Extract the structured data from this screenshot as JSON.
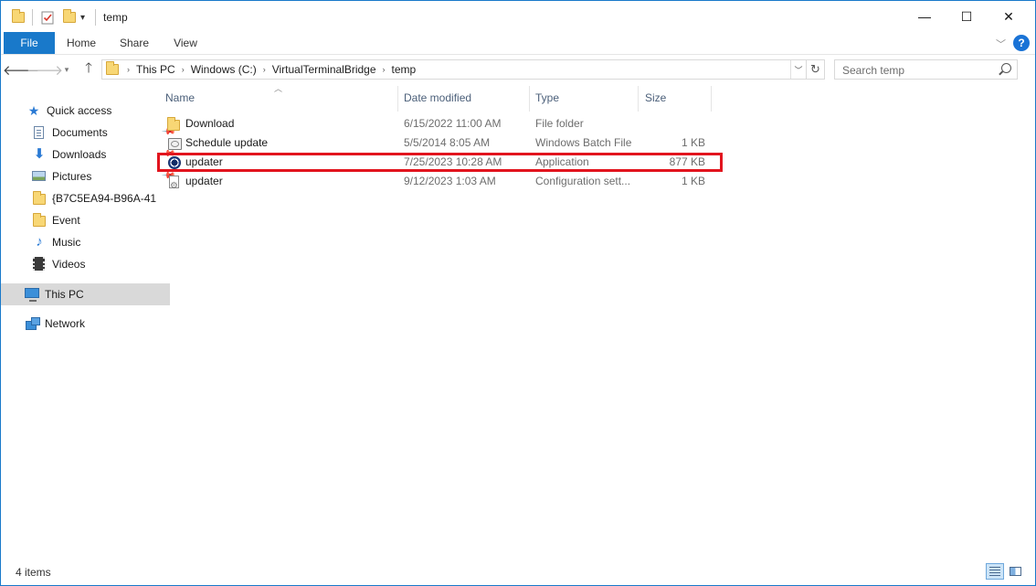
{
  "window": {
    "title": "temp",
    "minimize": "—",
    "maximize": "☐",
    "close": "✕"
  },
  "ribbon": {
    "tabs": [
      "File",
      "Home",
      "Share",
      "View"
    ],
    "help": "?"
  },
  "address": {
    "crumbs": [
      "This PC",
      "Windows (C:)",
      "VirtualTerminalBridge",
      "temp"
    ],
    "search_placeholder": "Search temp"
  },
  "nav": {
    "items": [
      {
        "label": "Quick access",
        "icon": "star-icon"
      },
      {
        "label": "Documents",
        "icon": "documents-icon",
        "pinned": true
      },
      {
        "label": "Downloads",
        "icon": "downloads-icon",
        "pinned": true
      },
      {
        "label": "Pictures",
        "icon": "pictures-icon",
        "pinned": true
      },
      {
        "label": "{B7C5EA94-B96A-41",
        "icon": "folder-icon"
      },
      {
        "label": "Event",
        "icon": "folder-icon"
      },
      {
        "label": "Music",
        "icon": "music-icon"
      },
      {
        "label": "Videos",
        "icon": "videos-icon"
      },
      {
        "label": "This PC",
        "icon": "this-pc-icon",
        "selected": true
      },
      {
        "label": "Network",
        "icon": "network-icon"
      }
    ]
  },
  "columns": {
    "name": "Name",
    "date": "Date modified",
    "type": "Type",
    "size": "Size"
  },
  "files": [
    {
      "name": "Download",
      "date": "6/15/2022 11:00 AM",
      "type": "File folder",
      "size": "",
      "icon": "folder-icon"
    },
    {
      "name": "Schedule update",
      "date": "5/5/2014 8:05 AM",
      "type": "Windows Batch File",
      "size": "1 KB",
      "icon": "batch-file-icon"
    },
    {
      "name": "updater",
      "date": "7/25/2023 10:28 AM",
      "type": "Application",
      "size": "877 KB",
      "icon": "application-icon"
    },
    {
      "name": "updater",
      "date": "9/12/2023 1:03 AM",
      "type": "Configuration sett...",
      "size": "1 KB",
      "icon": "config-file-icon"
    }
  ],
  "status": {
    "items_count": "4 items"
  },
  "colors": {
    "accent": "#1979ca",
    "highlight": "#e2141e"
  }
}
